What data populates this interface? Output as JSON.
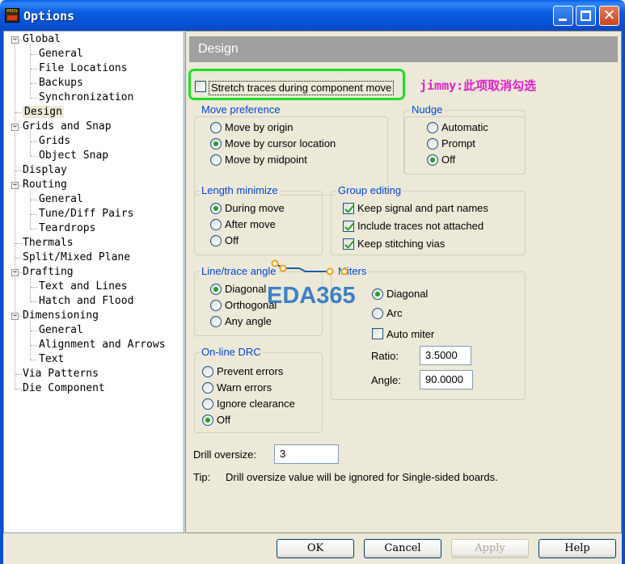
{
  "window": {
    "title": "Options",
    "app_icon_text": "PADS",
    "close_glyph": "✕"
  },
  "tree": {
    "items": [
      {
        "label": "Global",
        "level": 0,
        "expander": "⊟"
      },
      {
        "label": "General",
        "level": 1
      },
      {
        "label": "File Locations",
        "level": 1
      },
      {
        "label": "Backups",
        "level": 1
      },
      {
        "label": "Synchronization",
        "level": 1
      },
      {
        "label": "Design",
        "level": 0,
        "selected": true
      },
      {
        "label": "Grids and Snap",
        "level": 0,
        "expander": "⊟"
      },
      {
        "label": "Grids",
        "level": 1
      },
      {
        "label": "Object Snap",
        "level": 1
      },
      {
        "label": "Display",
        "level": 0
      },
      {
        "label": "Routing",
        "level": 0,
        "expander": "⊟"
      },
      {
        "label": "General",
        "level": 1
      },
      {
        "label": "Tune/Diff Pairs",
        "level": 1
      },
      {
        "label": "Teardrops",
        "level": 1
      },
      {
        "label": "Thermals",
        "level": 0
      },
      {
        "label": "Split/Mixed Plane",
        "level": 0
      },
      {
        "label": "Drafting",
        "level": 0,
        "expander": "⊟"
      },
      {
        "label": "Text and Lines",
        "level": 1
      },
      {
        "label": "Hatch and Flood",
        "level": 1
      },
      {
        "label": "Dimensioning",
        "level": 0,
        "expander": "⊟"
      },
      {
        "label": "General",
        "level": 1
      },
      {
        "label": "Alignment and Arrows",
        "level": 1
      },
      {
        "label": "Text",
        "level": 1
      },
      {
        "label": "Via Patterns",
        "level": 0
      },
      {
        "label": "Die Component",
        "level": 0
      }
    ]
  },
  "design": {
    "header": "Design",
    "stretch_traces": {
      "label": "Stretch traces during component move",
      "checked": false
    },
    "annotation": "jimmy:此项取消勾选",
    "move_preference": {
      "label": "Move preference",
      "options": [
        {
          "label": "Move by origin",
          "selected": false
        },
        {
          "label": "Move by cursor location",
          "selected": true
        },
        {
          "label": "Move by midpoint",
          "selected": false
        }
      ]
    },
    "nudge": {
      "label": "Nudge",
      "options": [
        {
          "label": "Automatic",
          "selected": false
        },
        {
          "label": "Prompt",
          "selected": false
        },
        {
          "label": "Off",
          "selected": true
        }
      ]
    },
    "length_minimize": {
      "label": "Length minimize",
      "options": [
        {
          "label": "During move",
          "selected": true
        },
        {
          "label": "After move",
          "selected": false
        },
        {
          "label": "Off",
          "selected": false
        }
      ]
    },
    "group_editing": {
      "label": "Group editing",
      "options": [
        {
          "label": "Keep signal and part names",
          "checked": true
        },
        {
          "label": "Include traces not attached",
          "checked": true
        },
        {
          "label": "Keep stitching vias",
          "checked": true
        }
      ]
    },
    "line_trace_angle": {
      "label": "Line/trace angle",
      "options": [
        {
          "label": "Diagonal",
          "selected": true
        },
        {
          "label": "Orthogonal",
          "selected": false
        },
        {
          "label": "Any angle",
          "selected": false
        }
      ]
    },
    "miters": {
      "label": "Miters",
      "options": [
        {
          "label": "Diagonal",
          "selected": true
        },
        {
          "label": "Arc",
          "selected": false
        }
      ],
      "auto_miter": {
        "label": "Auto miter",
        "checked": false
      },
      "ratio_label": "Ratio:",
      "ratio_value": "3.5000",
      "angle_label": "Angle:",
      "angle_value": "90.0000"
    },
    "online_drc": {
      "label": "On-line DRC",
      "options": [
        {
          "label": "Prevent errors",
          "selected": false
        },
        {
          "label": "Warn errors",
          "selected": false
        },
        {
          "label": "Ignore clearance",
          "selected": false
        },
        {
          "label": "Off",
          "selected": true
        }
      ]
    },
    "drill_oversize": {
      "label": "Drill oversize:",
      "value": "3"
    },
    "tip": {
      "label": "Tip:",
      "text": "Drill oversize value will be ignored for Single-sided boards."
    }
  },
  "watermark": {
    "text": "EDA365"
  },
  "buttons": {
    "ok": "OK",
    "cancel": "Cancel",
    "apply": "Apply",
    "help": "Help"
  },
  "colors": {
    "accent": "#0046d5",
    "title_bar": "#0b5ddf",
    "radio_check": "#21a121",
    "highlight": "#22dd22",
    "annotation": "#e01ec8"
  }
}
